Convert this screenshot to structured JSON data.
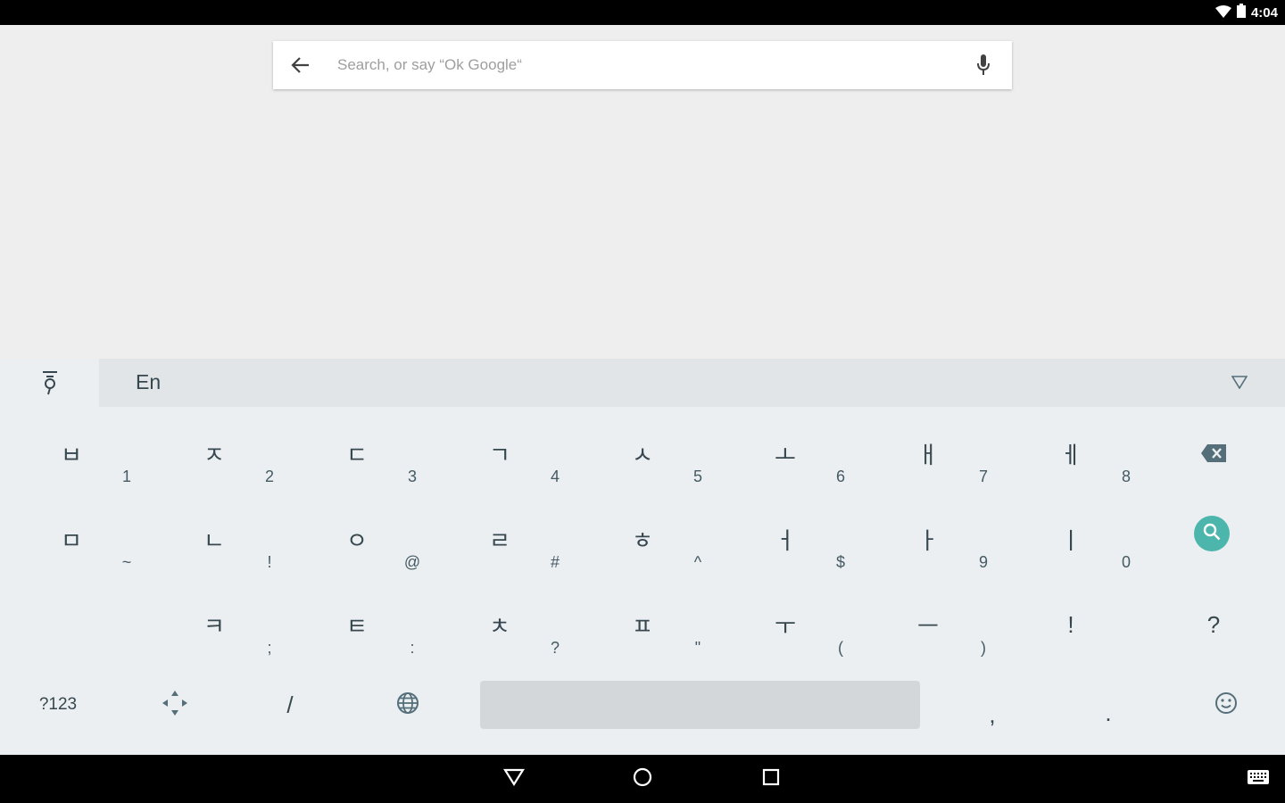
{
  "status_bar": {
    "time": "4:04"
  },
  "search": {
    "placeholder": "Search, or say “Ok Google“",
    "value": ""
  },
  "suggestion_bar": {
    "language_label": "En"
  },
  "keyboard": {
    "row1": [
      {
        "main": "ㅂ",
        "sub": "1"
      },
      {
        "main": "ㅈ",
        "sub": "2"
      },
      {
        "main": "ㄷ",
        "sub": "3"
      },
      {
        "main": "ㄱ",
        "sub": "4"
      },
      {
        "main": "ㅅ",
        "sub": "5"
      },
      {
        "main": "ㅗ",
        "sub": "6"
      },
      {
        "main": "ㅐ",
        "sub": "7"
      },
      {
        "main": "ㅔ",
        "sub": "8"
      }
    ],
    "row2": [
      {
        "main": "ㅁ",
        "sub": "~"
      },
      {
        "main": "ㄴ",
        "sub": "!"
      },
      {
        "main": "ㅇ",
        "sub": "@"
      },
      {
        "main": "ㄹ",
        "sub": "#"
      },
      {
        "main": "ㅎ",
        "sub": "^"
      },
      {
        "main": "ㅓ",
        "sub": "$"
      },
      {
        "main": "ㅏ",
        "sub": "9"
      },
      {
        "main": "ㅣ",
        "sub": "0"
      }
    ],
    "row3": [
      {
        "main": "ㅋ",
        "sub": ";"
      },
      {
        "main": "ㅌ",
        "sub": ":"
      },
      {
        "main": "ㅊ",
        "sub": "?"
      },
      {
        "main": "ㅍ",
        "sub": "\""
      },
      {
        "main": "ㅜ",
        "sub": "("
      },
      {
        "main": "ㅡ",
        "sub": ")"
      },
      {
        "main": "!",
        "sub": ""
      },
      {
        "main": "?",
        "sub": ""
      }
    ],
    "bottom": {
      "symbols_label": "?123",
      "slash_label": "/",
      "comma_label": ",",
      "period_label": "."
    }
  },
  "colors": {
    "accent": "#4db6ac",
    "key_text": "#37474f",
    "keyboard_bg": "#eceff1"
  }
}
